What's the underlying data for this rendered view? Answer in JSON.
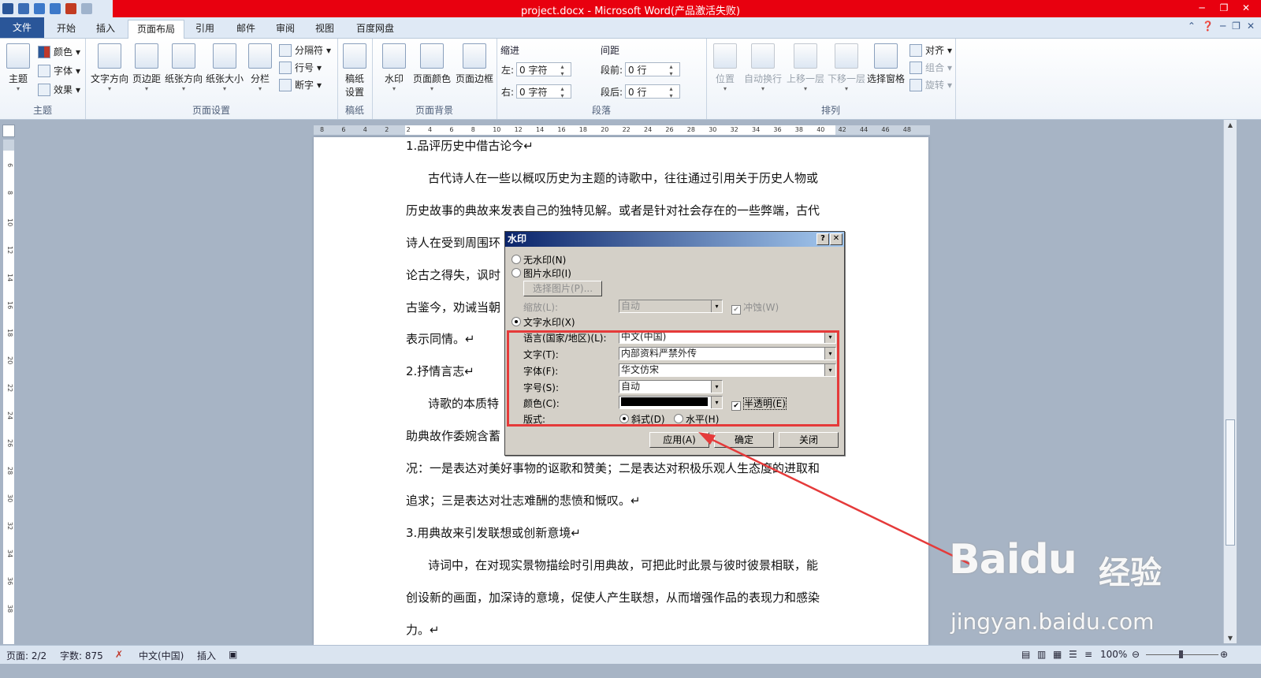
{
  "window": {
    "title": "project.docx - Microsoft Word(产品激活失败)"
  },
  "tabs": [
    "文件",
    "开始",
    "插入",
    "页面布局",
    "引用",
    "邮件",
    "审阅",
    "视图",
    "百度网盘"
  ],
  "ribbon": {
    "theme": {
      "label": "主题",
      "big": "主题",
      "small": [
        "颜色",
        "字体",
        "效果"
      ]
    },
    "page_setup": {
      "label": "页面设置",
      "big": [
        "文字方向",
        "页边距",
        "纸张方向",
        "纸张大小",
        "分栏"
      ],
      "small": [
        "分隔符",
        "行号",
        "断字"
      ]
    },
    "manuscript": {
      "label": "稿纸",
      "big": "稿纸设置"
    },
    "page_bg": {
      "label": "页面背景",
      "big": [
        "水印",
        "页面颜色",
        "页面边框"
      ]
    },
    "paragraph": {
      "label": "段落",
      "indent": "缩进",
      "spacing": "间距",
      "left": "左:",
      "right": "右:",
      "before": "段前:",
      "after": "段后:",
      "left_val": "0 字符",
      "right_val": "0 字符",
      "before_val": "0 行",
      "after_val": "0 行"
    },
    "arrange": {
      "label": "排列",
      "big": [
        "位置",
        "自动换行",
        "上移一层",
        "下移一层",
        "选择窗格"
      ],
      "small": [
        "对齐",
        "组合",
        "旋转"
      ]
    }
  },
  "ruler_h": [
    "8",
    "6",
    "4",
    "2",
    "2",
    "4",
    "6",
    "8",
    "10",
    "12",
    "14",
    "16",
    "18",
    "20",
    "22",
    "24",
    "26",
    "28",
    "30",
    "32",
    "34",
    "36",
    "38",
    "40",
    "42",
    "44",
    "46",
    "48"
  ],
  "ruler_v": [
    "6",
    "8",
    "10",
    "12",
    "14",
    "16",
    "18",
    "20",
    "22",
    "24",
    "26",
    "28",
    "30",
    "32",
    "34",
    "36",
    "38"
  ],
  "document": {
    "lines": [
      "1.品评历史中借古论今↵",
      "古代诗人在一些以概叹历史为主题的诗歌中，往往通过引用关于历史人物或",
      "历史故事的典故来发表自己的独特见解。或者是针对社会存在的一些弊端，古代",
      "诗人在受到周围环",
      "论古之得失，讽时",
      "古鉴今，劝诫当朝",
      "表示同情。↵",
      "2.抒情言志↵",
      "诗歌的本质特",
      "助典故作委婉含蓄",
      "况：一是表达对美好事物的讴歌和赞美；二是表达对积极乐观人生态度的进取和",
      "追求；三是表达对壮志难酬的悲愤和慨叹。↵",
      "3.用典故来引发联想或创新意境↵",
      "诗词中，在对现实景物描绘时引用典故，可把此时此景与彼时彼景相联，能",
      "创设新的画面，加深诗的意境，促使人产生联想，从而增强作品的表现力和感染",
      "力。↵"
    ]
  },
  "dialog": {
    "title": "水印",
    "help": "?",
    "close": "✕",
    "no_watermark": "无水印(N)",
    "picture_watermark": "图片水印(I)",
    "select_picture": "选择图片(P)...",
    "scale_label": "缩放(L):",
    "scale_value": "自动",
    "washout": "冲蚀(W)",
    "text_watermark": "文字水印(X)",
    "language_label": "语言(国家/地区)(L):",
    "language_value": "中文(中国)",
    "text_label": "文字(T):",
    "text_value": "内部资料严禁外传",
    "font_label": "字体(F):",
    "font_value": "华文仿宋",
    "size_label": "字号(S):",
    "size_value": "自动",
    "color_label": "颜色(C):",
    "color_value": "#000000",
    "semitransparent": "半透明(E)",
    "layout_label": "版式:",
    "diagonal": "斜式(D)",
    "horizontal": "水平(H)",
    "apply": "应用(A)",
    "ok": "确定",
    "cancel": "关闭"
  },
  "status": {
    "page": "页面: 2/2",
    "words": "字数: 875",
    "language": "中文(中国)",
    "mode": "插入",
    "zoom": "100%"
  },
  "watermark": {
    "brand": "Baidu",
    "product": "经验",
    "url": "jingyan.baidu.com"
  },
  "colors": {
    "title_bar": "#e8000f",
    "file_tab": "#2a5699",
    "highlight": "#e53a3a"
  }
}
